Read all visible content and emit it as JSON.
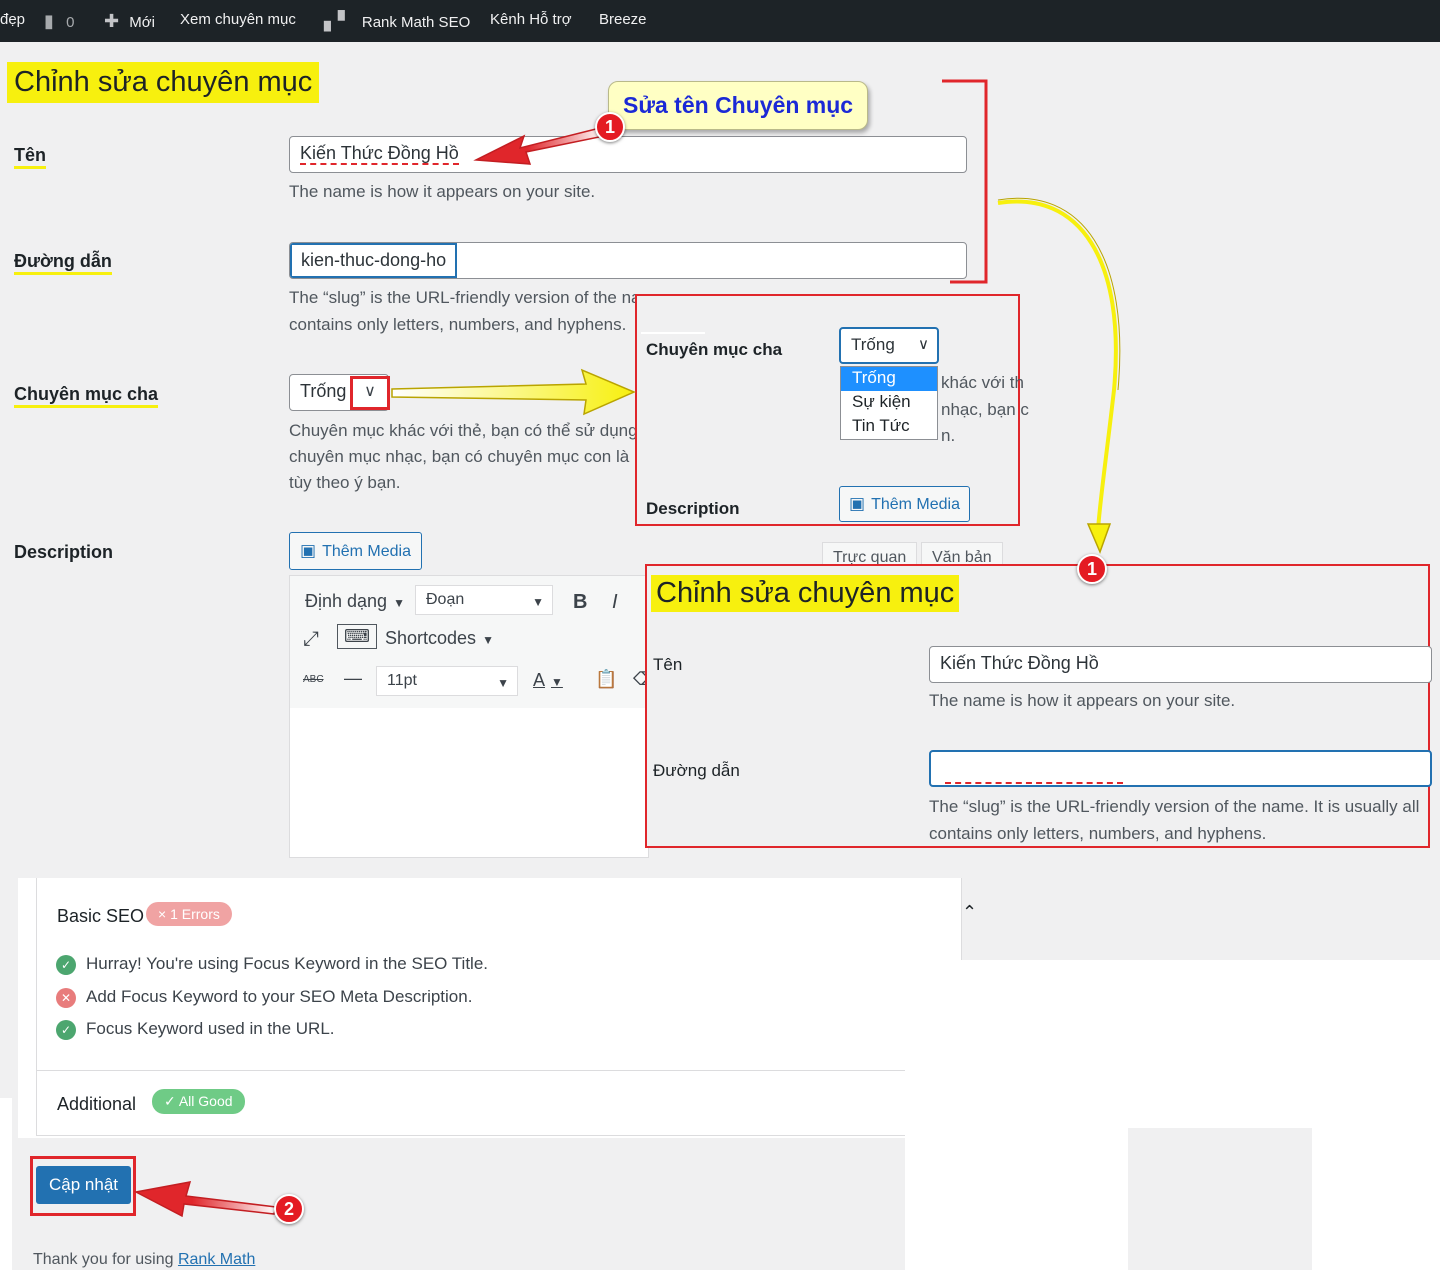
{
  "admin_bar": {
    "site_fragment": "đẹp",
    "comments_count": "0",
    "new_label": "Mới",
    "view_category": "Xem chuyên mục",
    "rank_math": "Rank Math SEO",
    "support_channel": "Kênh Hỗ trợ",
    "breeze": "Breeze"
  },
  "page": {
    "title": "Chỉnh sửa chuyên mục"
  },
  "form": {
    "name_label": "Tên",
    "name_value": "Kiến Thức Đồng Hồ",
    "name_help": "The name is how it appears on your site.",
    "slug_label": "Đường dẫn",
    "slug_value": "kien-thuc-dong-ho",
    "slug_help_line1": "The “slug” is the URL-friendly version of the name. It is usually all lowercase and",
    "slug_help_line2": "contains only letters, numbers, and hyphens.",
    "parent_label": "Chuyên mục cha",
    "parent_value": "Trống",
    "parent_help_line1": "Chuyên mục khác với thẻ, bạn có thể sử dụng nhiều cấp chuyên mục. Ví dụ: Trong",
    "parent_help_line2": "chuyên mục nhạc, bạn có chuyên mục con là nhạc Pop, nhạc Jazz. Việc này hoàn toàn",
    "parent_help_line3": "tùy theo ý bạn.",
    "description_label": "Description",
    "add_media": "Thêm Media",
    "tab_visual": "Trực quan",
    "tab_text": "Văn bản"
  },
  "editor_toolbar": {
    "format_menu": "Định dạng",
    "paragraph_select": "Đoạn",
    "bold": "B",
    "italic": "I",
    "shortcodes": "Shortcodes",
    "strike": "ABC",
    "font_size": "11pt",
    "text_color": "A"
  },
  "callouts": {
    "rename_bubble": "Sửa tên Chuyên mục",
    "badge_1": "1",
    "badge_2": "2"
  },
  "zoom_parent": {
    "label": "Chuyên mục cha",
    "selected": "Trống",
    "options": [
      "Trống",
      "Sự kiện",
      "Tin Tức"
    ],
    "help_frag1": "khác với th",
    "help_frag2": "nhạc, bạn c",
    "help_frag3": "n.",
    "description_label": "Description",
    "add_media": "Thêm Media"
  },
  "zoom_edit": {
    "title": "Chỉnh sửa chuyên mục",
    "name_label": "Tên",
    "name_value": "Kiến Thức Đồng Hồ",
    "name_help": "The name is how it appears on your site.",
    "slug_label": "Đường dẫn",
    "slug_value": "",
    "slug_help_line1": "The “slug” is the URL-friendly version of the name. It is usually all",
    "slug_help_line2": "contains only letters, numbers, and hyphens."
  },
  "seo": {
    "basic_title": "Basic SEO",
    "basic_badge": "× 1 Errors",
    "checks": [
      {
        "text": "Hurray! You're using Focus Keyword in the SEO Title.",
        "status": "pass"
      },
      {
        "text": "Add Focus Keyword to your SEO Meta Description.",
        "status": "fail"
      },
      {
        "text": "Focus Keyword used in the URL.",
        "status": "pass"
      }
    ],
    "additional_title": "Additional",
    "additional_badge": "✓ All Good"
  },
  "actions": {
    "update": "Cập nhật"
  },
  "footer": {
    "thanks_prefix": "Thank you for using ",
    "thanks_link": "Rank Math"
  },
  "colors": {
    "highlight": "#f7f00e",
    "callout_red": "#e0262b",
    "wp_blue": "#2271b1",
    "pass_green": "#4ca66f",
    "fail_red": "#e87c7c"
  }
}
